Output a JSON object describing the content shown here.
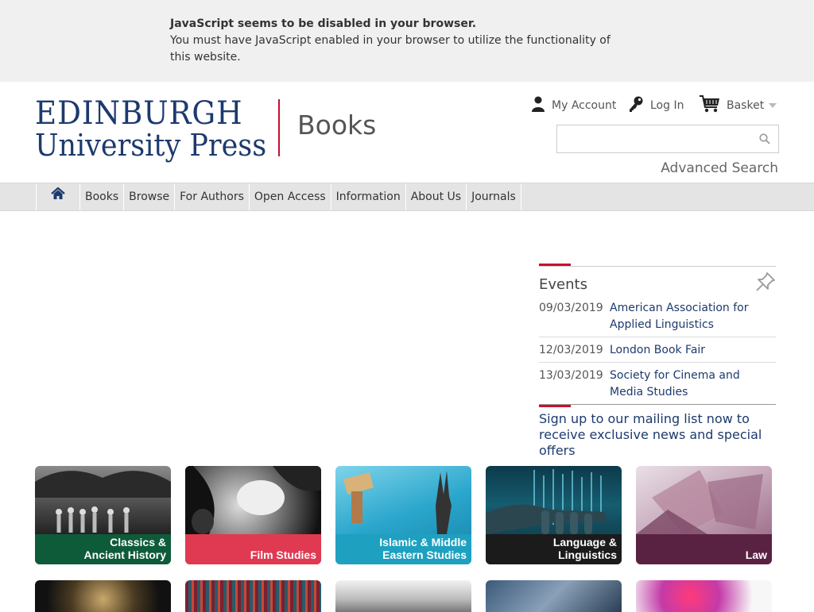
{
  "noscript": {
    "title": "JavaScript seems to be disabled in your browser.",
    "message": "You must have JavaScript enabled in your browser to utilize the functionality of this website."
  },
  "header": {
    "logo_line1": "EDINBURGH",
    "logo_line2": "University Press",
    "logo_section": "Books",
    "my_account": "My Account",
    "log_in": "Log In",
    "basket": "Basket",
    "search_placeholder": "",
    "advanced_search": "Advanced Search"
  },
  "nav": {
    "items": [
      {
        "label": "Books"
      },
      {
        "label": "Browse"
      },
      {
        "label": "For Authors"
      },
      {
        "label": "Open Access"
      },
      {
        "label": "Information"
      },
      {
        "label": "About Us"
      },
      {
        "label": "Journals"
      }
    ]
  },
  "events": {
    "title": "Events",
    "items": [
      {
        "date": "09/03/2019",
        "name": "American Association for Applied Linguistics"
      },
      {
        "date": "12/03/2019",
        "name": "London Book Fair"
      },
      {
        "date": "13/03/2019",
        "name": "Society for Cinema and Media Studies"
      }
    ]
  },
  "mailing": "Sign up to our mailing list now to receive exclusive news and special offers",
  "tiles": [
    {
      "line1": "Classics &",
      "line2": "Ancient History",
      "band_color": "#0e5b3a"
    },
    {
      "line1": "",
      "line2": "Film Studies",
      "band_color": "#e03a52"
    },
    {
      "line1": "Islamic & Middle",
      "line2": "Eastern Studies",
      "band_color": "#1ea0c0"
    },
    {
      "line1": "Language &",
      "line2": "Linguistics",
      "band_color": "#1b1b1b"
    },
    {
      "line1": "",
      "line2": "Law",
      "band_color": "#5a2242"
    }
  ],
  "colors": {
    "brand_navy": "#1d3a6e",
    "brand_red": "#c8102e"
  }
}
